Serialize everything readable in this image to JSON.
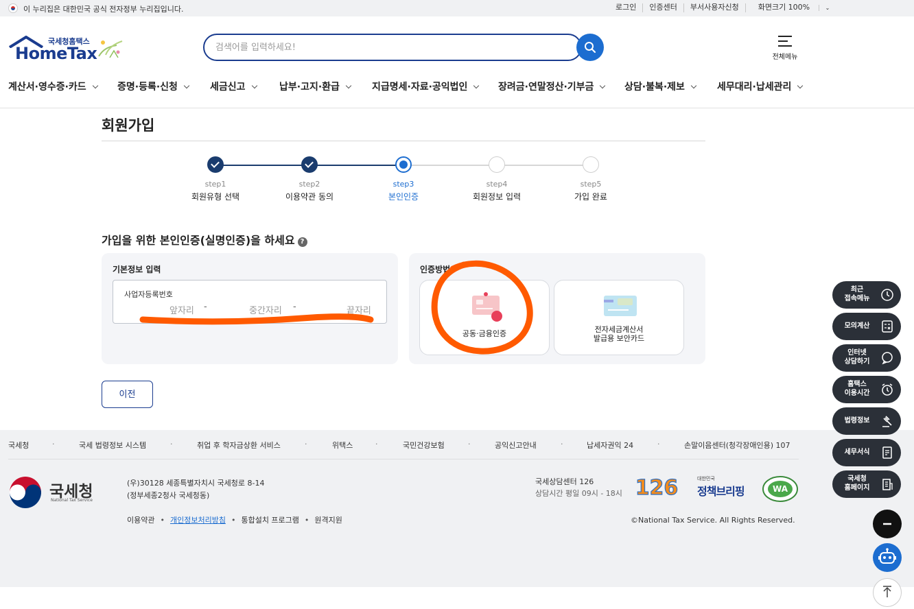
{
  "govbar": {
    "text": "이 누리집은 대한민국 공식 전자정부 누리집입니다.",
    "links": [
      "로그인",
      "인증센터",
      "부서사용자신청",
      "화면크기 100%"
    ]
  },
  "header": {
    "logo_small": "국세청홈택스",
    "logo_big": "HomeTax",
    "search_placeholder": "검색어를 입력하세요!",
    "all_menu": "전체메뉴"
  },
  "gnb": [
    "계산서·영수증·카드",
    "증명·등록·신청",
    "세금신고",
    "납부·고지·환급",
    "지급명세·자료·공익법인",
    "장려금·연말정산·기부금",
    "상담·불복·제보",
    "세무대리·납세관리"
  ],
  "page": {
    "title": "회원가입",
    "steps": [
      {
        "num": "step1",
        "label": "회원유형 선택",
        "state": "done"
      },
      {
        "num": "step2",
        "label": "이용약관 동의",
        "state": "done"
      },
      {
        "num": "step3",
        "label": "본인인증",
        "state": "current"
      },
      {
        "num": "step4",
        "label": "회원정보 입력",
        "state": "todo"
      },
      {
        "num": "step5",
        "label": "가입 완료",
        "state": "todo"
      }
    ],
    "section_title": "가입을 위한 본인인증(실명인증)을 하세요",
    "basic_info": {
      "title": "기본정보 입력",
      "biz_label": "사업자등록번호",
      "seg1": "앞자리",
      "seg2": "중간자리",
      "seg3": "끝자리",
      "dash": "-"
    },
    "auth": {
      "title": "인증방법",
      "card1": "공동·금융인증",
      "card2_line1": "전자세금계산서",
      "card2_line2": "발급용 보안카드"
    },
    "prev_button": "이전"
  },
  "footer": {
    "links": [
      "국세청",
      "국세 법령정보 시스템",
      "취업 후 학자금상환 서비스",
      "위택스",
      "국민건강보험",
      "공익신고안내",
      "납세자권익 24",
      "손말이음센터(청각장애인용) 107"
    ],
    "org_name": "국세청",
    "org_eng": "National Tax Service",
    "addr1": "(우)30128 세종특별자치시 국세청로 8-14",
    "addr2": "(정부세종2청사 국세청동)",
    "bottom_links": [
      "이용약관",
      "개인정보처리방침",
      "통합설치 프로그램",
      "원격지원"
    ],
    "center": "국세상담센터 126",
    "hours": "상담시간 평일 09시 - 18시",
    "logo126": "126",
    "policy_small": "대한민국",
    "policy_big": "정책브리핑",
    "wa_mark": "WA",
    "copyright": "©National Tax Service. All Rights Reserved."
  },
  "quick_menu": [
    {
      "l1": "최근",
      "l2": "접속메뉴",
      "icon": "clock-icon"
    },
    {
      "l1": "모의계산",
      "l2": "",
      "icon": "calculator-icon"
    },
    {
      "l1": "인터넷",
      "l2": "상담하기",
      "icon": "chat-icon"
    },
    {
      "l1": "홈택스",
      "l2": "이용시간",
      "icon": "alarm-icon"
    },
    {
      "l1": "법령정보",
      "l2": "",
      "icon": "gavel-icon"
    },
    {
      "l1": "세무서식",
      "l2": "",
      "icon": "form-icon"
    },
    {
      "l1": "국세청",
      "l2": "홈페이지",
      "icon": "building-icon"
    }
  ],
  "colors": {
    "brand": "#1a3c8f",
    "accent": "#1c6dd0",
    "scribble": "#ff5a00",
    "quick_menu_bg": "#2b3038"
  }
}
